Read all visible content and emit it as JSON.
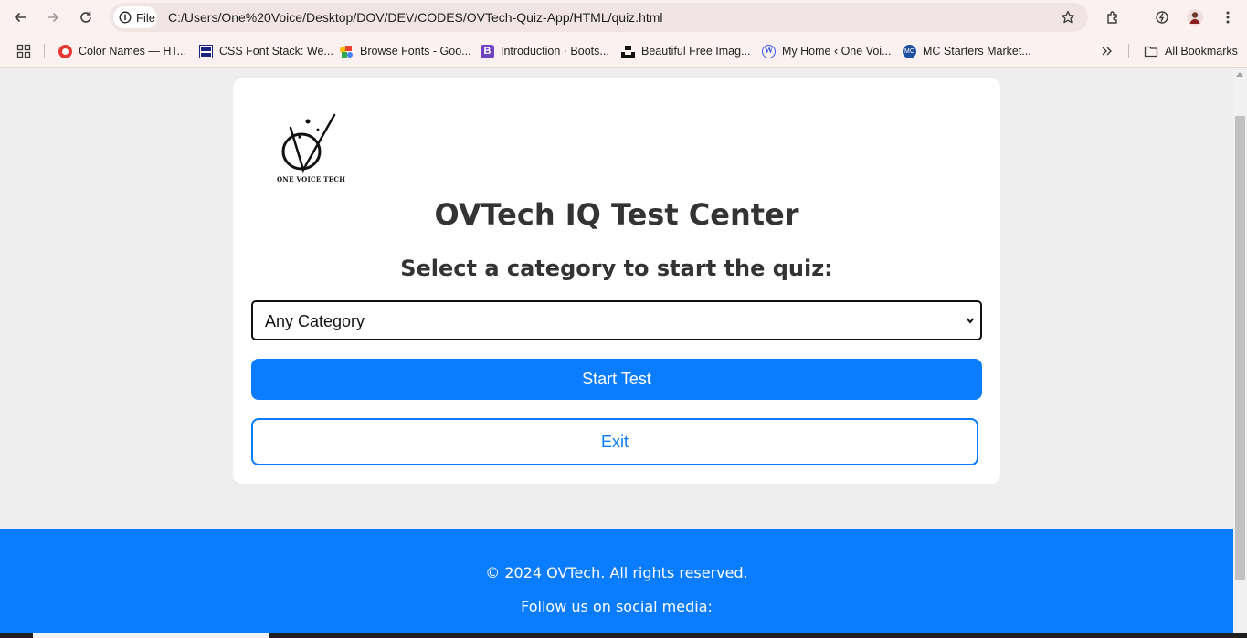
{
  "browser": {
    "chip_label": "File",
    "url": "C:/Users/One%20Voice/Desktop/DOV/DEV/CODES/OVTech-Quiz-App/HTML/quiz.html",
    "bookmarks": [
      {
        "label": "Color Names — HT...",
        "icon": "red-circle-icon"
      },
      {
        "label": "CSS Font Stack: We...",
        "icon": "cssfontstack-icon"
      },
      {
        "label": "Browse Fonts - Goo...",
        "icon": "google-fonts-icon"
      },
      {
        "label": "Introduction · Boots...",
        "icon": "bootstrap-icon"
      },
      {
        "label": "Beautiful Free Imag...",
        "icon": "unsplash-icon"
      },
      {
        "label": "My Home ‹ One Voi...",
        "icon": "wordpress-icon"
      },
      {
        "label": "MC Starters Market...",
        "icon": "mc-icon"
      }
    ],
    "all_bookmarks_label": "All Bookmarks"
  },
  "page": {
    "logo_text": "ONE VOICE TECH",
    "title": "OVTech IQ Test Center",
    "subtitle": "Select a category to start the quiz:",
    "category_select": {
      "value": "Any Category"
    },
    "start_label": "Start Test",
    "exit_label": "Exit"
  },
  "footer": {
    "copyright": "© 2024 OVTech. All rights reserved.",
    "follow": "Follow us on social media:"
  },
  "colors": {
    "primary": "#0a7cff",
    "background": "#eeeeee",
    "heading": "#333333"
  }
}
